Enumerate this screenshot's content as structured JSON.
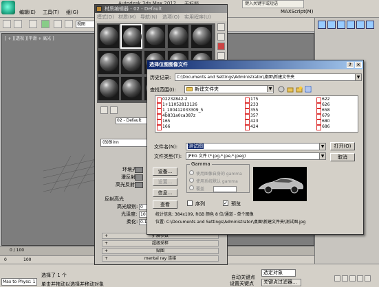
{
  "app": {
    "title_partial": "Autodesk 3ds Max 2012",
    "untitled": "无标题",
    "search_placeholder": "键入关键字或短语",
    "menus": [
      "编辑(E)",
      "工具(T)",
      "组(G)",
      "MAXScript(M)"
    ],
    "viewport_label": "[ + ][透视 ][平滑 + 高光 ]",
    "view_select": "视图",
    "time_counter": "0 / 100",
    "ruler_start": "0",
    "ruler_next": "100"
  },
  "status": {
    "maxscript": "Max to Physc: 1",
    "line1": "选择了 1 个",
    "line2": "单击并拖动以选择并移动对象",
    "autokey": "自动关键点",
    "setkey": "设置关键点",
    "selected_object": "选定对象",
    "key_filters": "关键点过滤器..."
  },
  "material_editor": {
    "title": "材质编辑器 - 02 - Default",
    "menus": [
      "模式(D)",
      "材质(M)",
      "导航(N)",
      "选项(O)",
      "实用程序(U)"
    ],
    "material_name": "02 - Default",
    "shader": "(B)Blinn",
    "ambient": "环境光:",
    "diffuse": "漫反射:",
    "specular": "高光反射:",
    "specular_highlights": "反射高光",
    "specular_level": "高光级别:",
    "glossiness": "光泽度:",
    "soften": "柔化:",
    "specular_level_value": "0",
    "glossiness_value": "10",
    "soften_value": "0.1",
    "rollouts": [
      "扩展参数",
      "超级采样",
      "贴图",
      "mental ray 连接"
    ]
  },
  "dialog": {
    "title": "选择位图图像文件",
    "help": "?",
    "close": "×",
    "history_label": "历史记录:",
    "history_value": "C:\\Documents and Settings\\Administrator\\桌面\\新建文件夹",
    "lookin_label": "查找范围(I):",
    "lookin_value": "新建文件夹",
    "files_col1": [
      "02232842-2",
      "1+11052813126",
      "1_100412033309_5",
      "4b831a0ca387z",
      "165",
      "166"
    ],
    "files_col2": [
      "175",
      "233",
      "355",
      "357",
      "423",
      "424"
    ],
    "files_col3": [
      "622",
      "626",
      "658",
      "679",
      "680",
      "686"
    ],
    "filename_label": "文件名(N):",
    "filename_value": "测试图",
    "filetype_label": "文件类型(T):",
    "filetype_value": "JPEG 文件 (*.jpg,*.jpe,*.jpeg)",
    "open_btn": "打开(O)",
    "cancel_btn": "取消",
    "setup_btn": "设备...",
    "settings_btn": "设置...",
    "info_btn": "信息...",
    "view_btn": "查看",
    "gamma_title": "Gamma",
    "gamma_opt1": "使用图像自身的 gamma",
    "gamma_opt2": "使用系统默认 gamma",
    "gamma_opt3": "覆盖",
    "sequence_label": "序列",
    "preview_label": "预览",
    "stats": "统计信息: 384x109, RGB 颜色 8 位/通道 - 单个图像",
    "location": "位置: C:\\Documents and Settings\\Administrator\\桌面\\新建文件夹\\测试图.jpg"
  }
}
